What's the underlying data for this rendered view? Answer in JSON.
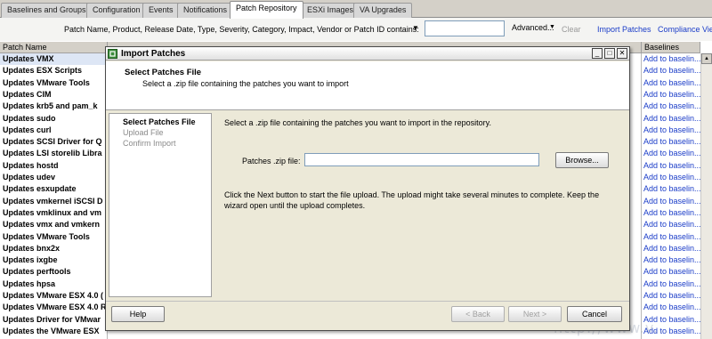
{
  "tabs": [
    {
      "label": "Baselines and Groups"
    },
    {
      "label": "Configuration"
    },
    {
      "label": "Events"
    },
    {
      "label": "Notifications"
    },
    {
      "label": "Patch Repository"
    },
    {
      "label": "ESXi Images"
    },
    {
      "label": "VA Upgrades"
    }
  ],
  "filter": {
    "label": "Patch Name, Product, Release Date, Type, Severity, Category, Impact, Vendor or Patch ID contains:",
    "value": "",
    "advanced": "Advanced...",
    "clear": "Clear",
    "import_patches": "Import Patches",
    "compliance_view": "Compliance View"
  },
  "table": {
    "columns": {
      "patch_name": "Patch Name",
      "baselines": "Baselines"
    },
    "rows": [
      {
        "name": "Updates VMX",
        "action": "Add to baselin..."
      },
      {
        "name": "Updates ESX Scripts",
        "action": "Add to baselin..."
      },
      {
        "name": "Updates VMware Tools",
        "action": "Add to baselin..."
      },
      {
        "name": "Updates CIM",
        "action": "Add to baselin..."
      },
      {
        "name": "Updates krb5 and pam_k",
        "action": "Add to baselin..."
      },
      {
        "name": "Updates sudo",
        "action": "Add to baselin..."
      },
      {
        "name": "Updates curl",
        "action": "Add to baselin..."
      },
      {
        "name": "Updates SCSI Driver for Q",
        "action": "Add to baselin..."
      },
      {
        "name": "Updates LSI storelib Libra",
        "action": "Add to baselin..."
      },
      {
        "name": "Updates hostd",
        "action": "Add to baselin..."
      },
      {
        "name": "Updates udev",
        "action": "Add to baselin..."
      },
      {
        "name": "Updates esxupdate",
        "action": "Add to baselin..."
      },
      {
        "name": "Updates vmkernel iSCSI D",
        "action": "Add to baselin..."
      },
      {
        "name": "Updates vmklinux and vm",
        "action": "Add to baselin..."
      },
      {
        "name": "Updates vmx and vmkern",
        "action": "Add to baselin..."
      },
      {
        "name": "Updates VMware Tools",
        "action": "Add to baselin..."
      },
      {
        "name": "Updates bnx2x",
        "action": "Add to baselin..."
      },
      {
        "name": "Updates ixgbe",
        "action": "Add to baselin..."
      },
      {
        "name": "Updates perftools",
        "action": "Add to baselin..."
      },
      {
        "name": "Updates hpsa",
        "action": "Add to baselin..."
      },
      {
        "name": "Updates VMware ESX 4.0 (",
        "action": "Add to baselin..."
      },
      {
        "name": "Updates VMware ESX 4.0 R",
        "action": "Add to baselin..."
      },
      {
        "name": "Updates Driver for VMwar",
        "action": "Add to baselin..."
      },
      {
        "name": "Updates the VMware ESX",
        "action": "Add to baselin..."
      }
    ]
  },
  "dialog": {
    "title": "Import Patches",
    "header_title": "Select Patches File",
    "header_subtitle": "Select a .zip file containing the patches you want to import",
    "steps": [
      "Select Patches File",
      "Upload File",
      "Confirm Import"
    ],
    "content_text": "Select a .zip file containing the patches you want to import in the repository.",
    "field_label": "Patches .zip file:",
    "field_value": "",
    "browse_label": "Browse...",
    "instructions": "Click the Next button to start the file upload. The upload might take several minutes to complete. Keep the wizard open until the upload completes.",
    "buttons": {
      "help": "Help",
      "back": "< Back",
      "next": "Next >",
      "cancel": "Cancel"
    }
  },
  "watermark": "http://www.v...",
  "colors": {
    "link": "#1a3cc8",
    "dialog_bg": "#ece9d8",
    "tab_bg": "#d4d0c8"
  }
}
